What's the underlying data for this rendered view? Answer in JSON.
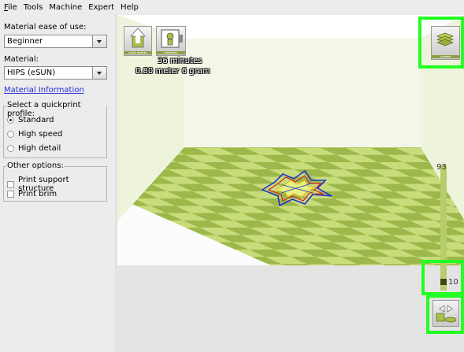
{
  "menubar": {
    "items": [
      {
        "label": "File",
        "mnemonic": "F",
        "rest": "ile"
      },
      {
        "label": "Tools",
        "mnemonic": "",
        "rest": "Tools"
      },
      {
        "label": "Machine",
        "mnemonic": "",
        "rest": "Machine"
      },
      {
        "label": "Expert",
        "mnemonic": "",
        "rest": "Expert"
      },
      {
        "label": "Help",
        "mnemonic": "",
        "rest": "Help"
      }
    ]
  },
  "sidebar": {
    "ease_label": "Material ease of use:",
    "ease_value": "Beginner",
    "material_label": "Material:",
    "material_value": "HIPS (eSUN)",
    "material_info_link": "Material Information",
    "quickprint": {
      "legend": "Select a quickprint profile:",
      "options": [
        {
          "label": "Standard",
          "selected": true
        },
        {
          "label": "High speed",
          "selected": false
        },
        {
          "label": "High detail",
          "selected": false
        }
      ]
    },
    "other": {
      "legend": "Other options:",
      "options": [
        {
          "label": "Print support structure",
          "checked": false
        },
        {
          "label": "Print brim",
          "checked": false
        }
      ]
    }
  },
  "viewport": {
    "buttons": {
      "load_model": "LOAD MODEL",
      "control": "CONTROL",
      "layers": "LAYERS"
    },
    "print_time": "36 minutes",
    "print_material": "0.80 meter 6 gram",
    "layer_slider": {
      "max_label": "93",
      "current_label": "10",
      "max": 93,
      "current": 10
    }
  },
  "colors": {
    "highlight": "#22ff22",
    "bed_light": "#c8dc7c",
    "bed_dark": "#9cb84a",
    "accent": "#8aa043"
  }
}
